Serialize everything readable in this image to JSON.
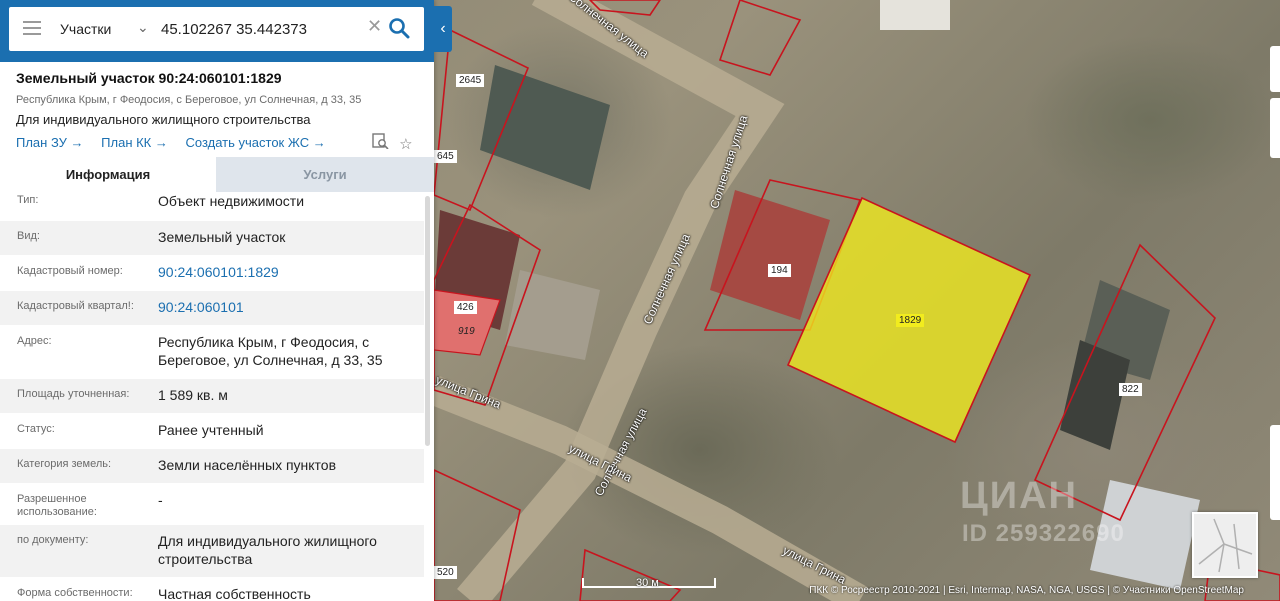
{
  "search": {
    "type_label": "Участки",
    "query": "45.102267 35.442373"
  },
  "parcel": {
    "title": "Земельный участок 90:24:060101:1829",
    "address_short": "Республика Крым, г Феодосия, с Береговое, ул Солнечная, д 33, 35",
    "purpose": "Для индивидуального жилищного строительства"
  },
  "links": {
    "plan_zu": "План ЗУ →",
    "plan_kk": "План КК →",
    "create_zs": "Создать участок ЖС →"
  },
  "tabs": {
    "info": "Информация",
    "services": "Услуги"
  },
  "info_rows": [
    {
      "key": "Тип:",
      "value": "Объект недвижимости"
    },
    {
      "key": "Вид:",
      "value": "Земельный участок"
    },
    {
      "key": "Кадастровый номер:",
      "value": "90:24:060101:1829"
    },
    {
      "key": "Кадастровый квартал!:",
      "value": "90:24:060101"
    },
    {
      "key": "Адрес:",
      "value": "Республика Крым, г Феодосия, с Береговое, ул Солнечная, д 33, 35"
    },
    {
      "key": "Площадь уточненная:",
      "value": "1 589 кв. м"
    },
    {
      "key": "Статус:",
      "value": "Ранее учтенный"
    },
    {
      "key": "Категория земель:",
      "value": "Земли населённых пунктов"
    },
    {
      "key": "Разрешенное использование:",
      "value": "-"
    },
    {
      "key": "по документу:",
      "value": "Для индивидуального жилищного строительства"
    },
    {
      "key": "Форма собственности:",
      "value": "Частная собственность"
    }
  ],
  "map": {
    "parcel_labels": {
      "p1829": "1829",
      "p194": "194",
      "p426": "426",
      "p919": "919",
      "p822": "822",
      "p2645": "2645",
      "p645": "645",
      "p520": "520"
    },
    "streets": {
      "s1": "Солнечная улица",
      "s2": "Солнечная улица",
      "s3": "Солнечная улица",
      "s4": "улица Грина",
      "s5": "улица Грина",
      "s6": "улица Грина"
    },
    "watermark": "ЦИАН",
    "watermark_id": "ID 259322690",
    "scale_label": "30 м",
    "attribution": "ПКК © Росреестр 2010-2021 | Esri, Intermap, NASA, NGA, USGS | © Участники OpenStreetMap"
  },
  "colors": {
    "accent": "#1b6fb0",
    "selected_parcel_fill": "#f2ec1e",
    "parcel_border": "#c8141e"
  }
}
